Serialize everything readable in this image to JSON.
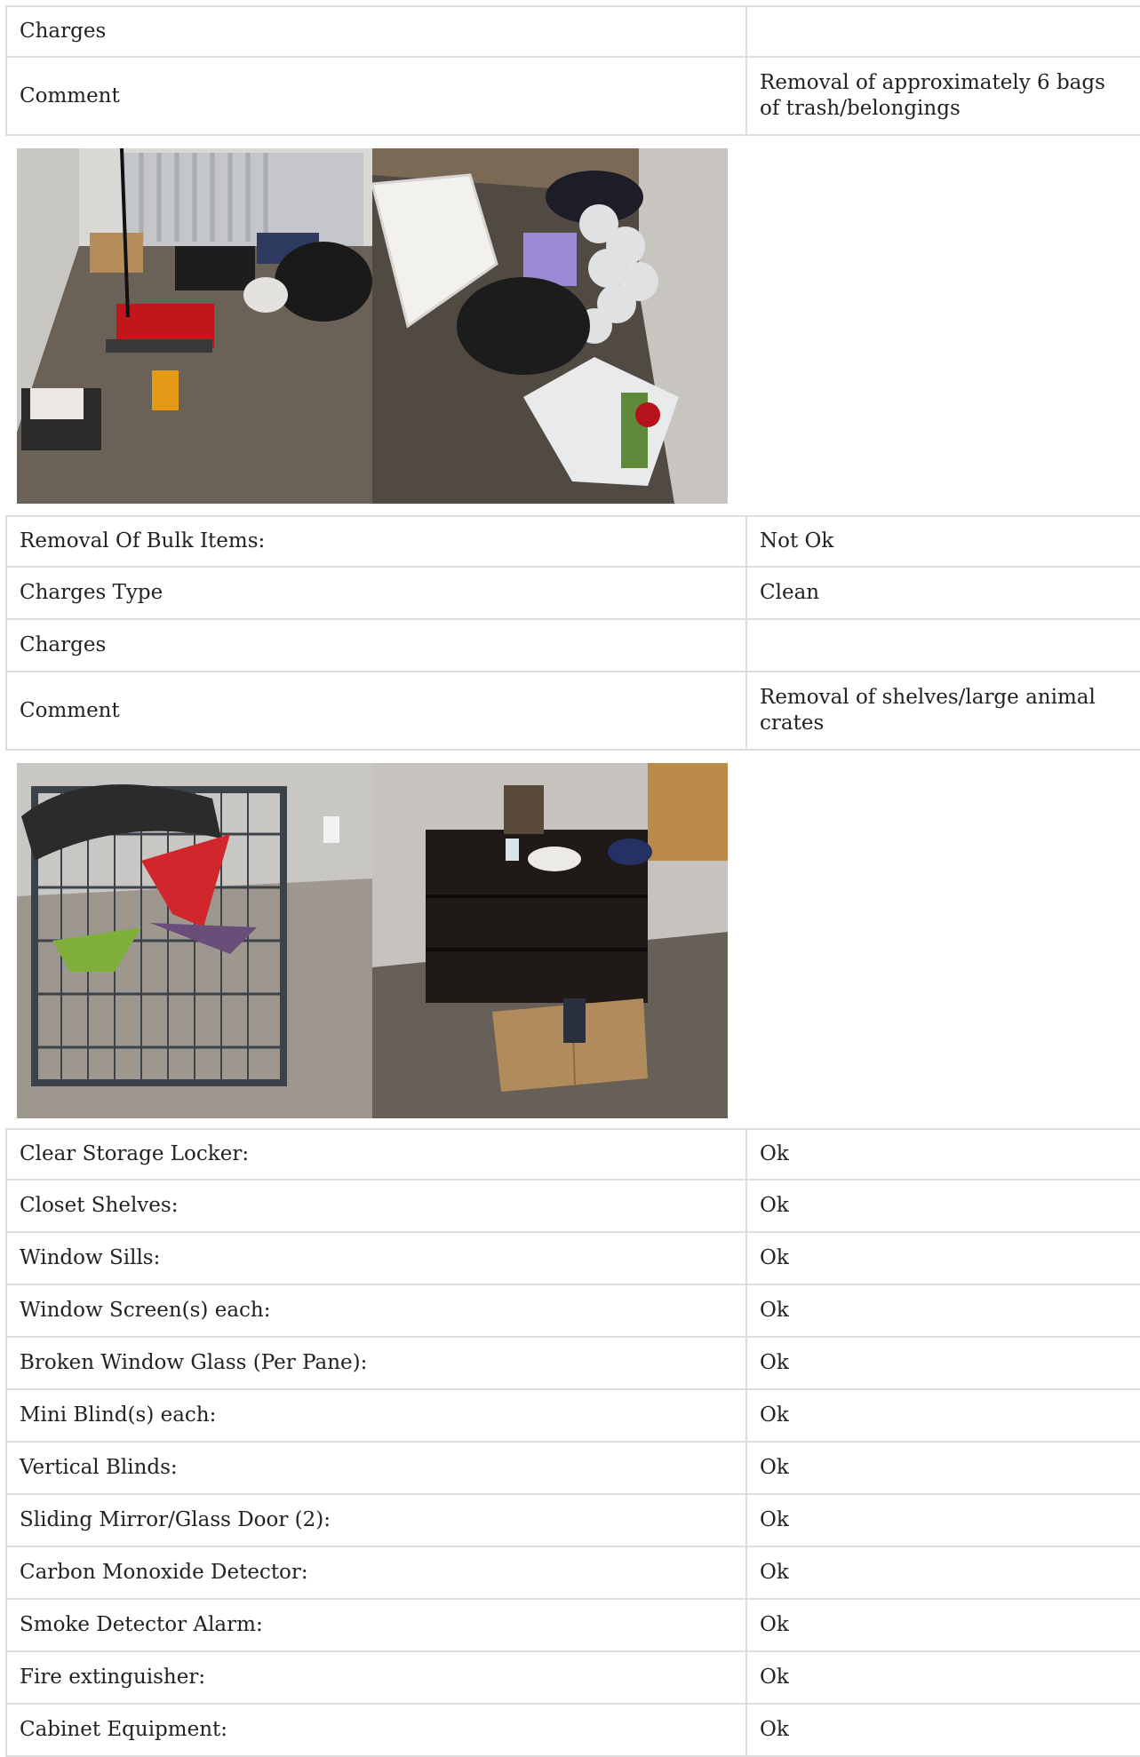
{
  "section1": {
    "charges_label": "Charges",
    "charges_value": "",
    "comment_label": "Comment",
    "comment_value": "Removal of approximately 6 bags of trash/belongings"
  },
  "photos1": [
    "trash-bags-in-room-photo",
    "bags-and-laundry-basket-photo"
  ],
  "section2": {
    "removal_label": "Removal Of Bulk Items:",
    "removal_value": "Not Ok",
    "charges_type_label": "Charges Type",
    "charges_type_value": "Clean",
    "charges_label": "Charges",
    "charges_value": "",
    "comment_label": "Comment",
    "comment_value": "Removal of shelves/large animal crates"
  },
  "photos2": [
    "animal-crate-photo",
    "bookshelf-with-boxes-photo"
  ],
  "items": [
    {
      "label": "Clear Storage Locker:",
      "value": "Ok"
    },
    {
      "label": "Closet Shelves:",
      "value": "Ok"
    },
    {
      "label": "Window Sills:",
      "value": "Ok"
    },
    {
      "label": "Window Screen(s) each:",
      "value": "Ok"
    },
    {
      "label": "Broken Window Glass (Per Pane):",
      "value": "Ok"
    },
    {
      "label": "Mini Blind(s) each:",
      "value": "Ok"
    },
    {
      "label": "Vertical Blinds:",
      "value": "Ok"
    },
    {
      "label": "Sliding Mirror/Glass Door (2):",
      "value": "Ok"
    },
    {
      "label": "Carbon Monoxide Detector:",
      "value": "Ok"
    },
    {
      "label": "Smoke Detector Alarm:",
      "value": "Ok"
    },
    {
      "label": "Fire extinguisher:",
      "value": "Ok"
    },
    {
      "label": "Cabinet Equipment:",
      "value": "Ok"
    }
  ]
}
